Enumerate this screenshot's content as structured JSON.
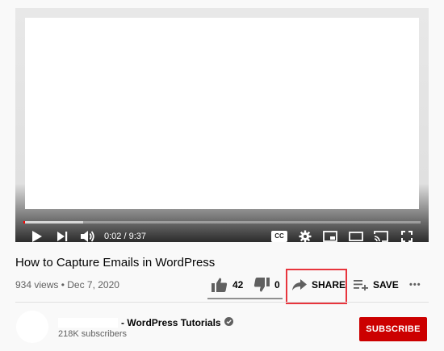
{
  "player": {
    "time_display": "0:02 / 9:37",
    "progress_fraction": 0.0035,
    "buffered_fraction": 0.15,
    "icons": [
      "play-icon",
      "next-icon",
      "volume-icon",
      "captions-icon",
      "settings-icon",
      "miniplayer-icon",
      "theater-icon",
      "cast-icon",
      "fullscreen-icon"
    ],
    "cc_label": "CC"
  },
  "video": {
    "title": "How to Capture Emails in WordPress",
    "meta": "934 views • Dec 7, 2020"
  },
  "actions": {
    "like_count": "42",
    "dislike_count": "0",
    "share_label": "SHARE",
    "save_label": "SAVE",
    "more_label": "•••"
  },
  "channel": {
    "name_suffix": "- WordPress Tutorials",
    "subscribers": "218K subscribers",
    "subscribe_label": "SUBSCRIBE"
  },
  "colors": {
    "accent_red": "#cc0000",
    "highlight_box": "#e8353d",
    "progress_red": "#ff0000"
  }
}
